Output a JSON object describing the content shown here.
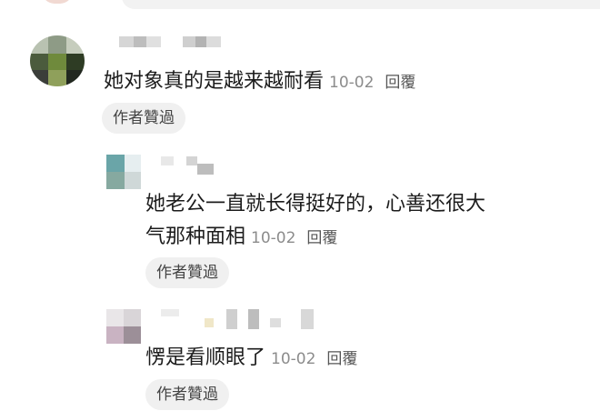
{
  "comments": [
    {
      "text": "她对象真的是越来越耐看",
      "date": "10-02",
      "reply_label": "回覆",
      "badge": "作者贊過"
    },
    {
      "line1": "她老公一直就长得挺好的，心善还很大",
      "line2": "气那种面相",
      "date": "10-02",
      "reply_label": "回覆",
      "badge": "作者贊過"
    },
    {
      "text": "愣是看顺眼了",
      "date": "10-02",
      "reply_label": "回覆",
      "badge": "作者贊過"
    }
  ]
}
